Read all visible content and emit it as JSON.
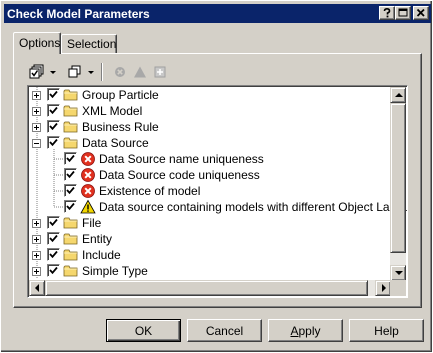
{
  "window": {
    "title": "Check Model Parameters",
    "title_bar_color": "#0a246a"
  },
  "tabs": [
    {
      "label": "Options",
      "active": true
    },
    {
      "label": "Selection",
      "active": false
    }
  ],
  "toolbar": {
    "icons": [
      "select-all-icon",
      "dropdown-arrow-icon",
      "copy-icon",
      "dropdown-arrow-icon",
      "stop-icon",
      "warning-triangle-icon",
      "add-icon"
    ]
  },
  "tree": {
    "items": [
      {
        "label": "Group Particle",
        "type": "folder",
        "expanded": false,
        "checked": true,
        "level": 0
      },
      {
        "label": "XML Model",
        "type": "folder",
        "expanded": false,
        "checked": true,
        "level": 0
      },
      {
        "label": "Business Rule",
        "type": "folder",
        "expanded": false,
        "checked": true,
        "level": 0
      },
      {
        "label": "Data Source",
        "type": "folder",
        "expanded": true,
        "checked": true,
        "level": 0
      },
      {
        "label": "Data Source name uniqueness",
        "type": "error",
        "checked": true,
        "level": 1
      },
      {
        "label": "Data Source code uniqueness",
        "type": "error",
        "checked": true,
        "level": 1
      },
      {
        "label": "Existence of model",
        "type": "error",
        "checked": true,
        "level": 1
      },
      {
        "label": "Data source containing models with different Object Language",
        "type": "warning",
        "checked": true,
        "level": 1
      },
      {
        "label": "File",
        "type": "folder",
        "expanded": false,
        "checked": true,
        "level": 0
      },
      {
        "label": "Entity",
        "type": "folder",
        "expanded": false,
        "checked": true,
        "level": 0
      },
      {
        "label": "Include",
        "type": "folder",
        "expanded": false,
        "checked": true,
        "level": 0
      },
      {
        "label": "Simple Type",
        "type": "folder",
        "expanded": false,
        "checked": true,
        "level": 0
      }
    ]
  },
  "buttons": {
    "ok": "OK",
    "cancel": "Cancel",
    "apply": "Apply",
    "help": "Help"
  },
  "colors": {
    "dialog_bg": "#d4d0c8",
    "folder": "#f5d76e",
    "error": "#e0301e",
    "warning": "#f2d600"
  }
}
